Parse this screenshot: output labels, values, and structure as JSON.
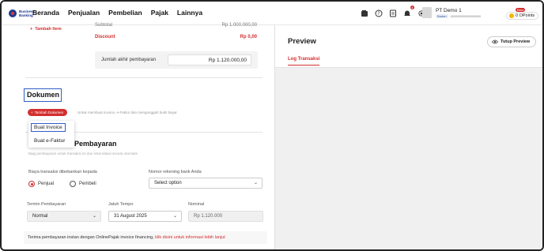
{
  "brand": {
    "name_line1": "Business",
    "name_line2": "Banking"
  },
  "nav": {
    "items": [
      "Beranda",
      "Penjualan",
      "Pembelian",
      "Pajak",
      "Lainnya"
    ]
  },
  "header": {
    "notification_count": "4",
    "company_name": "PT Demo 1",
    "company_role": "Badan",
    "company_id": "0000000000000000000",
    "points_badge": "Baru",
    "points_text": "0 OPoints"
  },
  "items": {
    "add_item_label": "Tambah Item"
  },
  "summary": {
    "subtotal_label": "Subtotal",
    "subtotal_value": "Rp 1.000.000,00",
    "discount_label": "Discount",
    "discount_value": "Rp 0,00",
    "total_label": "Jumlah akhir pembayaran",
    "total_value": "Rp 1.120.000,00"
  },
  "documents": {
    "title": "Dokumen",
    "add_button": "Tambah Dokumen",
    "hint": "Untuk membuat invoice, e-Faktur dan mengunggah bukti bayar",
    "menu": [
      "Buat Invoice",
      "Buat e-Faktur"
    ]
  },
  "payment": {
    "title": "Pembayaran",
    "hint": "Bagi pembayaran untuk transaksi ini dan rekonsiliasi secara otomatis",
    "fee_label": "Biaya transaksi dibebankan kepada",
    "fee_options": [
      "Penjual",
      "Pembeli"
    ],
    "fee_selected": "Penjual",
    "bank_label": "Nomor rekening bank Anda",
    "bank_placeholder": "Select option",
    "term_label": "Termin Pembayaran",
    "term_value": "Normal",
    "due_label": "Jatuh Tempo",
    "due_value": "31 August 2025",
    "amount_label": "Nominal",
    "amount_value": "Rp 1.120.000",
    "notice_text": "Terima pembayaran instan dengan OnlinePajak invoice financing, ",
    "notice_link": "klik disini untuk informasi lebih lanjut"
  },
  "preview": {
    "title": "Preview",
    "close_button": "Tutup Preview",
    "tab": "Log Transaksi"
  },
  "colors": {
    "accent": "#d32f2f",
    "highlight": "#2f5fc4",
    "brand": "#1a3a8f"
  }
}
